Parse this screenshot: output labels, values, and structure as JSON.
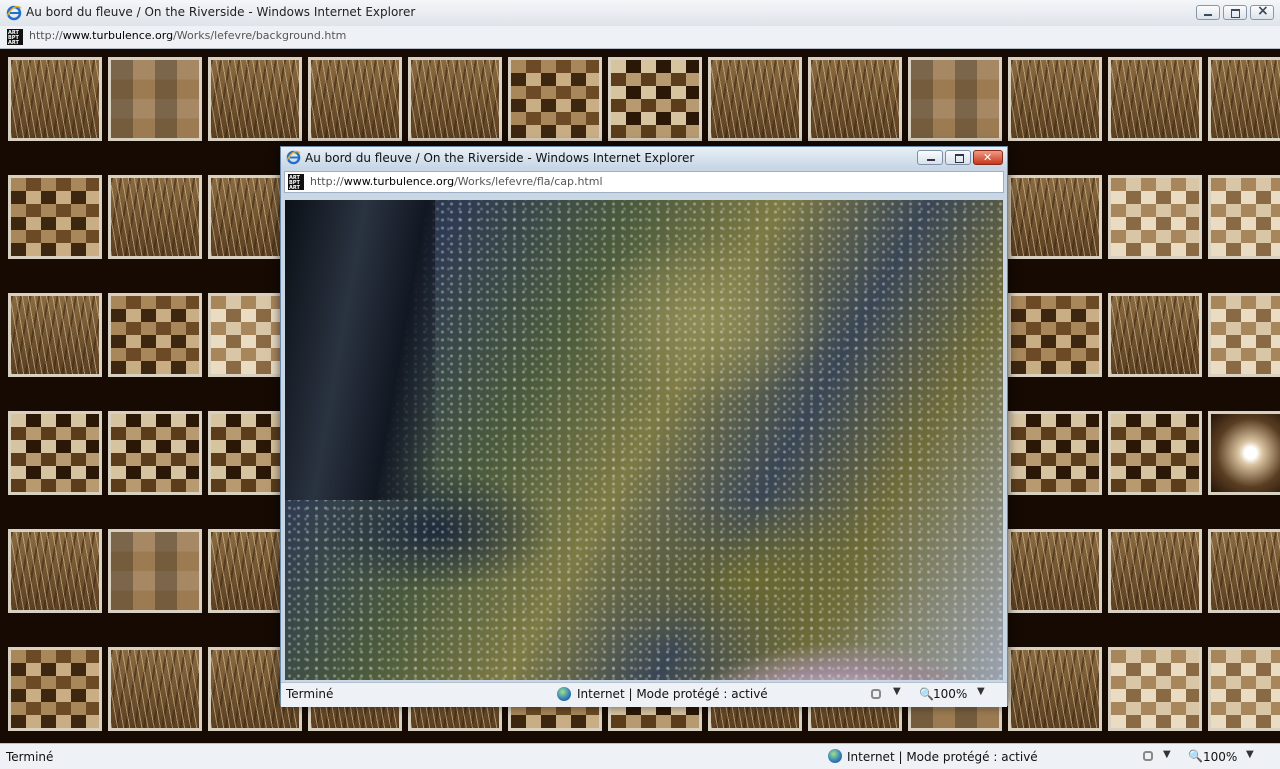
{
  "outer_window": {
    "title": "Au bord du fleuve / On the Riverside - Windows Internet Explorer",
    "url_prefix": "http://",
    "url_domain": "www.turbulence.org",
    "url_path": "/Works/lefevre/background.htm",
    "favicon_text": "ART BPT ART"
  },
  "popup_window": {
    "title": "Au bord du fleuve / On the Riverside - Windows Internet Explorer",
    "url_prefix": "http://",
    "url_domain": "www.turbulence.org",
    "url_path": "/Works/lefevre/fla/cap.html",
    "status_text": "Terminé",
    "zone_text": "Internet | Mode protégé : activé",
    "zoom_text": "100%"
  },
  "status_bar": {
    "status_text": "Terminé",
    "zone_text": "Internet | Mode protégé : activé",
    "zoom_text": "100%"
  },
  "icons": {
    "dropdown": "▼",
    "zoom": "🔍"
  }
}
